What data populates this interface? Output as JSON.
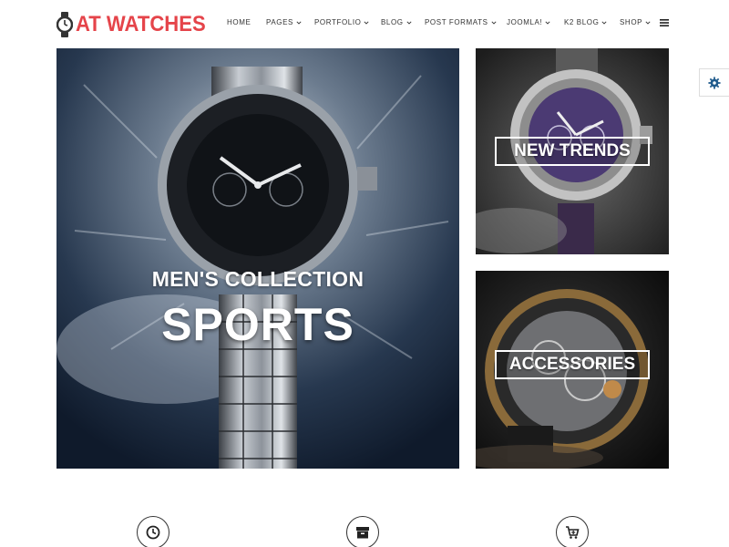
{
  "brand": {
    "name": "AT WATCHES",
    "color": "#e5444a",
    "icon": "watch-icon"
  },
  "nav": {
    "items": [
      {
        "label": "HOME",
        "has_dropdown": false
      },
      {
        "label": "PAGES",
        "has_dropdown": true
      },
      {
        "label": "PORTFOLIO",
        "has_dropdown": true
      },
      {
        "label": "BLOG",
        "has_dropdown": true
      },
      {
        "label": "POST FORMATS",
        "has_dropdown": true
      },
      {
        "label": "JOOMLA!",
        "has_dropdown": true
      },
      {
        "label": "K2 BLOG",
        "has_dropdown": true
      },
      {
        "label": "SHOP",
        "has_dropdown": true
      }
    ],
    "menu_icon": "hamburger-icon"
  },
  "banners": {
    "main": {
      "subtitle": "MEN'S COLLECTION",
      "title": "SPORTS"
    },
    "top_right": {
      "label": "NEW TRENDS"
    },
    "bottom_right": {
      "label": "ACCESSORIES"
    }
  },
  "settings": {
    "icon": "gear-icon",
    "color": "#1e5a8c"
  },
  "features": [
    {
      "icon": "clock-icon"
    },
    {
      "icon": "archive-icon"
    },
    {
      "icon": "cart-plus-icon"
    }
  ]
}
